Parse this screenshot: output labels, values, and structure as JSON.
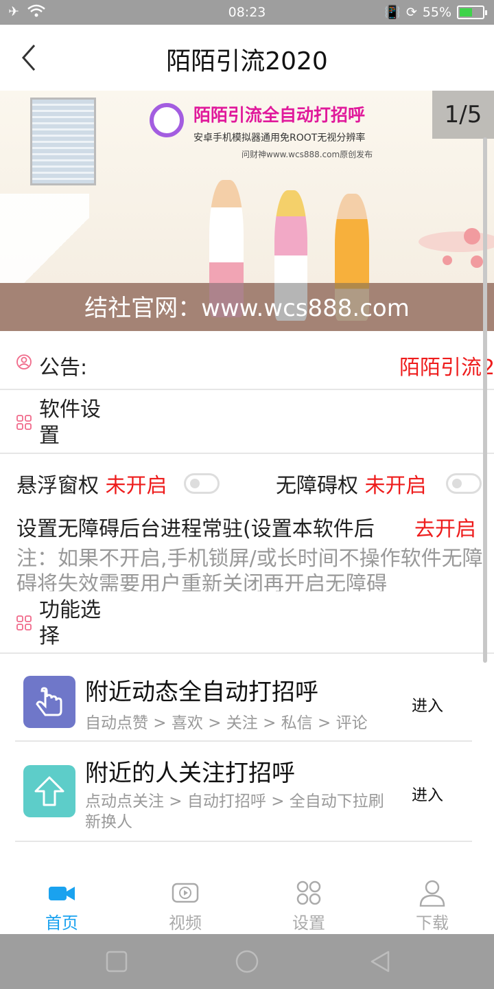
{
  "status_bar": {
    "time": "08:23",
    "battery": "55%",
    "battery_level": 0.55
  },
  "header": {
    "title": "陌陌引流2020"
  },
  "banner": {
    "promo_title": "陌陌引流全自动打招呼",
    "promo_sub": "安卓手机模拟器通用免ROOT无视分辨率",
    "promo_credit": "问财神www.wcs888.com原创发布",
    "caption": "结社官网：www.wcs888.com",
    "counter": "1/5"
  },
  "notice": {
    "label": "公告:",
    "text": "陌陌引流2"
  },
  "software_settings": {
    "title": "软件设置"
  },
  "permissions": {
    "float_label": "悬浮窗权",
    "float_status": "未开启",
    "access_label": "无障碍权",
    "access_status": "未开启"
  },
  "background": {
    "text": "设置无障碍后台进程常驻(设置本软件后",
    "link": "去开启"
  },
  "note": {
    "text": "注：如果不开启,手机锁屏/或长时间不操作软件无障碍将失效需要用户重新关闭再开启无障碍"
  },
  "feature_section": {
    "title": "功能选择"
  },
  "features": [
    {
      "name": "附近动态全自动打招呼",
      "desc": "自动点赞 > 喜欢 > 关注 > 私信 > 评论",
      "action": "进入",
      "color": "#6f77c9"
    },
    {
      "name": "附近的人关注打招呼",
      "desc": "点动点关注 > 自动打招呼 > 全自动下拉刷新换人",
      "action": "进入",
      "color": "#5dcdc9"
    }
  ],
  "tabs": [
    {
      "label": "首页",
      "icon": "video-camera-icon",
      "active": true
    },
    {
      "label": "视频",
      "icon": "play-icon",
      "active": false
    },
    {
      "label": "设置",
      "icon": "grid-icon",
      "active": false
    },
    {
      "label": "下载",
      "icon": "person-icon",
      "active": false
    }
  ],
  "colors": {
    "accent": "#1aa2ef",
    "warning": "#ee1c1c",
    "icon_pink": "#f06a8a"
  }
}
